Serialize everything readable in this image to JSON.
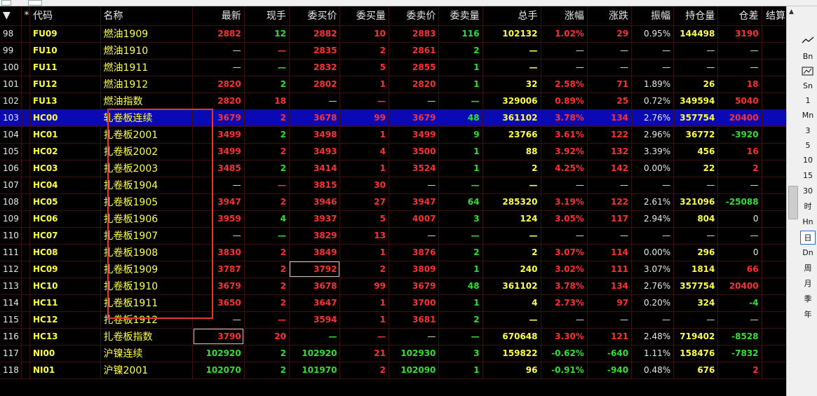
{
  "headers": [
    "",
    "*",
    "代码",
    "名称",
    "最新",
    "现手",
    "委买价",
    "委买量",
    "委卖价",
    "委卖量",
    "总手",
    "涨幅",
    "涨跌",
    "振幅",
    "持仓量",
    "仓差",
    "结算"
  ],
  "sort_indicator": "▼",
  "rows": [
    {
      "idx": "98",
      "code": "FU09",
      "name": "燃油1909",
      "cells": [
        [
          "2882",
          "red"
        ],
        [
          "12",
          "green"
        ],
        [
          "2882",
          "red"
        ],
        [
          "10",
          "red"
        ],
        [
          "2883",
          "red"
        ],
        [
          "116",
          "green"
        ],
        [
          "102132",
          "yellow"
        ],
        [
          "1.02%",
          "red"
        ],
        [
          "29",
          "red"
        ],
        [
          "0.95%",
          "white"
        ],
        [
          "144498",
          "yellow"
        ],
        [
          "3190",
          "red"
        ]
      ]
    },
    {
      "idx": "99",
      "code": "FU10",
      "name": "燃油1910",
      "cells": [
        [
          "—",
          "white"
        ],
        [
          "—",
          "red"
        ],
        [
          "2835",
          "red"
        ],
        [
          "2",
          "red"
        ],
        [
          "2861",
          "red"
        ],
        [
          "2",
          "green"
        ],
        [
          "—",
          "yellow"
        ],
        [
          "—",
          "white"
        ],
        [
          "—",
          "white"
        ],
        [
          "—",
          "white"
        ],
        [
          "—",
          "white"
        ],
        [
          "—",
          "white"
        ]
      ]
    },
    {
      "idx": "100",
      "code": "FU11",
      "name": "燃油1911",
      "cells": [
        [
          "—",
          "white"
        ],
        [
          "—",
          "green"
        ],
        [
          "2832",
          "red"
        ],
        [
          "5",
          "red"
        ],
        [
          "2855",
          "red"
        ],
        [
          "1",
          "green"
        ],
        [
          "—",
          "yellow"
        ],
        [
          "—",
          "white"
        ],
        [
          "—",
          "white"
        ],
        [
          "—",
          "white"
        ],
        [
          "—",
          "white"
        ],
        [
          "—",
          "white"
        ]
      ]
    },
    {
      "idx": "101",
      "code": "FU12",
      "name": "燃油1912",
      "cells": [
        [
          "2820",
          "red"
        ],
        [
          "2",
          "green"
        ],
        [
          "2802",
          "red"
        ],
        [
          "1",
          "red"
        ],
        [
          "2820",
          "red"
        ],
        [
          "1",
          "green"
        ],
        [
          "32",
          "yellow"
        ],
        [
          "2.58%",
          "red"
        ],
        [
          "71",
          "red"
        ],
        [
          "1.89%",
          "white"
        ],
        [
          "26",
          "yellow"
        ],
        [
          "18",
          "red"
        ]
      ]
    },
    {
      "idx": "102",
      "code": "FU13",
      "name": "燃油指数",
      "cells": [
        [
          "2820",
          "red"
        ],
        [
          "18",
          "red"
        ],
        [
          "—",
          "white"
        ],
        [
          "—",
          "red"
        ],
        [
          "—",
          "white"
        ],
        [
          "—",
          "green"
        ],
        [
          "329006",
          "yellow"
        ],
        [
          "0.89%",
          "red"
        ],
        [
          "25",
          "red"
        ],
        [
          "0.72%",
          "white"
        ],
        [
          "349594",
          "yellow"
        ],
        [
          "5040",
          "red"
        ]
      ]
    },
    {
      "idx": "103",
      "code": "HC00",
      "name": "轧卷板连续",
      "sel": true,
      "cells": [
        [
          "3679",
          "red"
        ],
        [
          "2",
          "red"
        ],
        [
          "3678",
          "red"
        ],
        [
          "99",
          "red"
        ],
        [
          "3679",
          "red"
        ],
        [
          "48",
          "green"
        ],
        [
          "361102",
          "yellow"
        ],
        [
          "3.78%",
          "red"
        ],
        [
          "134",
          "red"
        ],
        [
          "2.76%",
          "white"
        ],
        [
          "357754",
          "yellow"
        ],
        [
          "20400",
          "red"
        ]
      ]
    },
    {
      "idx": "104",
      "code": "HC01",
      "name": "扎卷板2001",
      "cells": [
        [
          "3499",
          "red"
        ],
        [
          "2",
          "green"
        ],
        [
          "3498",
          "red"
        ],
        [
          "1",
          "red"
        ],
        [
          "3499",
          "red"
        ],
        [
          "9",
          "green"
        ],
        [
          "23766",
          "yellow"
        ],
        [
          "3.61%",
          "red"
        ],
        [
          "122",
          "red"
        ],
        [
          "2.96%",
          "white"
        ],
        [
          "36772",
          "yellow"
        ],
        [
          "-3920",
          "green"
        ]
      ]
    },
    {
      "idx": "105",
      "code": "HC02",
      "name": "扎卷板2002",
      "cells": [
        [
          "3499",
          "red"
        ],
        [
          "2",
          "red"
        ],
        [
          "3493",
          "red"
        ],
        [
          "4",
          "red"
        ],
        [
          "3500",
          "red"
        ],
        [
          "1",
          "green"
        ],
        [
          "88",
          "yellow"
        ],
        [
          "3.92%",
          "red"
        ],
        [
          "132",
          "red"
        ],
        [
          "3.39%",
          "white"
        ],
        [
          "456",
          "yellow"
        ],
        [
          "16",
          "red"
        ]
      ]
    },
    {
      "idx": "106",
      "code": "HC03",
      "name": "扎卷板2003",
      "cells": [
        [
          "3485",
          "red"
        ],
        [
          "2",
          "green"
        ],
        [
          "3414",
          "red"
        ],
        [
          "1",
          "red"
        ],
        [
          "3524",
          "red"
        ],
        [
          "1",
          "green"
        ],
        [
          "2",
          "yellow"
        ],
        [
          "4.25%",
          "red"
        ],
        [
          "142",
          "red"
        ],
        [
          "0.00%",
          "white"
        ],
        [
          "22",
          "yellow"
        ],
        [
          "2",
          "red"
        ]
      ]
    },
    {
      "idx": "107",
      "code": "HC04",
      "name": "扎卷板1904",
      "cells": [
        [
          "—",
          "white"
        ],
        [
          "—",
          "red"
        ],
        [
          "3815",
          "red"
        ],
        [
          "30",
          "red"
        ],
        [
          "—",
          "white"
        ],
        [
          "—",
          "green"
        ],
        [
          "—",
          "yellow"
        ],
        [
          "—",
          "white"
        ],
        [
          "—",
          "white"
        ],
        [
          "—",
          "white"
        ],
        [
          "—",
          "white"
        ],
        [
          "—",
          "white"
        ]
      ]
    },
    {
      "idx": "108",
      "code": "HC05",
      "name": "扎卷板1905",
      "cells": [
        [
          "3947",
          "red"
        ],
        [
          "2",
          "red"
        ],
        [
          "3946",
          "red"
        ],
        [
          "27",
          "red"
        ],
        [
          "3947",
          "red"
        ],
        [
          "64",
          "green"
        ],
        [
          "285320",
          "yellow"
        ],
        [
          "3.19%",
          "red"
        ],
        [
          "122",
          "red"
        ],
        [
          "2.61%",
          "white"
        ],
        [
          "321096",
          "yellow"
        ],
        [
          "-25088",
          "green"
        ]
      ]
    },
    {
      "idx": "109",
      "code": "HC06",
      "name": "扎卷板1906",
      "cells": [
        [
          "3959",
          "red"
        ],
        [
          "4",
          "green"
        ],
        [
          "3937",
          "red"
        ],
        [
          "5",
          "red"
        ],
        [
          "4007",
          "red"
        ],
        [
          "3",
          "green"
        ],
        [
          "124",
          "yellow"
        ],
        [
          "3.05%",
          "red"
        ],
        [
          "117",
          "red"
        ],
        [
          "2.94%",
          "white"
        ],
        [
          "804",
          "yellow"
        ],
        [
          "0",
          "white"
        ]
      ]
    },
    {
      "idx": "110",
      "code": "HC07",
      "name": "扎卷板1907",
      "cells": [
        [
          "—",
          "white"
        ],
        [
          "—",
          "green"
        ],
        [
          "3829",
          "red"
        ],
        [
          "13",
          "red"
        ],
        [
          "—",
          "white"
        ],
        [
          "—",
          "green"
        ],
        [
          "—",
          "yellow"
        ],
        [
          "—",
          "white"
        ],
        [
          "—",
          "white"
        ],
        [
          "—",
          "white"
        ],
        [
          "—",
          "white"
        ],
        [
          "—",
          "white"
        ]
      ]
    },
    {
      "idx": "111",
      "code": "HC08",
      "name": "扎卷板1908",
      "cells": [
        [
          "3830",
          "red"
        ],
        [
          "2",
          "red"
        ],
        [
          "3849",
          "red"
        ],
        [
          "1",
          "red"
        ],
        [
          "3876",
          "red"
        ],
        [
          "2",
          "green"
        ],
        [
          "2",
          "yellow"
        ],
        [
          "3.07%",
          "red"
        ],
        [
          "114",
          "red"
        ],
        [
          "0.00%",
          "white"
        ],
        [
          "296",
          "yellow"
        ],
        [
          "0",
          "white"
        ]
      ]
    },
    {
      "idx": "112",
      "code": "HC09",
      "name": "扎卷板1909",
      "cells": [
        [
          "3787",
          "red"
        ],
        [
          "2",
          "red"
        ],
        [
          "3792",
          "red",
          true
        ],
        [
          "2",
          "red"
        ],
        [
          "3809",
          "red"
        ],
        [
          "1",
          "green"
        ],
        [
          "240",
          "yellow"
        ],
        [
          "3.02%",
          "red"
        ],
        [
          "111",
          "red"
        ],
        [
          "3.07%",
          "white"
        ],
        [
          "1814",
          "yellow"
        ],
        [
          "66",
          "red"
        ]
      ]
    },
    {
      "idx": "113",
      "code": "HC10",
      "name": "扎卷板1910",
      "cells": [
        [
          "3679",
          "red"
        ],
        [
          "2",
          "red"
        ],
        [
          "3678",
          "red"
        ],
        [
          "99",
          "red"
        ],
        [
          "3679",
          "red"
        ],
        [
          "48",
          "green"
        ],
        [
          "361102",
          "yellow"
        ],
        [
          "3.78%",
          "red"
        ],
        [
          "134",
          "red"
        ],
        [
          "2.76%",
          "white"
        ],
        [
          "357754",
          "yellow"
        ],
        [
          "20400",
          "red"
        ]
      ]
    },
    {
      "idx": "114",
      "code": "HC11",
      "name": "扎卷板1911",
      "cells": [
        [
          "3650",
          "red"
        ],
        [
          "2",
          "red"
        ],
        [
          "3647",
          "red"
        ],
        [
          "1",
          "red"
        ],
        [
          "3700",
          "red"
        ],
        [
          "1",
          "green"
        ],
        [
          "4",
          "yellow"
        ],
        [
          "2.73%",
          "red"
        ],
        [
          "97",
          "red"
        ],
        [
          "0.20%",
          "white"
        ],
        [
          "324",
          "yellow"
        ],
        [
          "-4",
          "green"
        ]
      ]
    },
    {
      "idx": "115",
      "code": "HC12",
      "name": "扎卷板1912",
      "cells": [
        [
          "—",
          "white"
        ],
        [
          "—",
          "red"
        ],
        [
          "3594",
          "red"
        ],
        [
          "1",
          "red"
        ],
        [
          "3681",
          "red"
        ],
        [
          "2",
          "green"
        ],
        [
          "—",
          "yellow"
        ],
        [
          "—",
          "white"
        ],
        [
          "—",
          "white"
        ],
        [
          "—",
          "white"
        ],
        [
          "—",
          "white"
        ],
        [
          "—",
          "white"
        ]
      ]
    },
    {
      "idx": "116",
      "code": "HC13",
      "name": "扎卷板指数",
      "cells": [
        [
          "3790",
          "red",
          true
        ],
        [
          "20",
          "red"
        ],
        [
          "—",
          "green"
        ],
        [
          "—",
          "red"
        ],
        [
          "—",
          "white"
        ],
        [
          "—",
          "green"
        ],
        [
          "670648",
          "yellow"
        ],
        [
          "3.30%",
          "red"
        ],
        [
          "121",
          "red"
        ],
        [
          "2.48%",
          "white"
        ],
        [
          "719402",
          "yellow"
        ],
        [
          "-8528",
          "green"
        ]
      ]
    },
    {
      "idx": "117",
      "code": "NI00",
      "name": "沪镍连续",
      "cells": [
        [
          "102920",
          "green"
        ],
        [
          "2",
          "green"
        ],
        [
          "102920",
          "green"
        ],
        [
          "21",
          "red"
        ],
        [
          "102930",
          "green"
        ],
        [
          "3",
          "green"
        ],
        [
          "159822",
          "yellow"
        ],
        [
          "-0.62%",
          "green"
        ],
        [
          "-640",
          "green"
        ],
        [
          "1.11%",
          "white"
        ],
        [
          "158476",
          "yellow"
        ],
        [
          "-7832",
          "green"
        ]
      ]
    },
    {
      "idx": "118",
      "code": "NI01",
      "name": "沪镍2001",
      "cells": [
        [
          "102070",
          "green"
        ],
        [
          "2",
          "green"
        ],
        [
          "101970",
          "green"
        ],
        [
          "2",
          "red"
        ],
        [
          "102090",
          "green"
        ],
        [
          "1",
          "green"
        ],
        [
          "96",
          "yellow"
        ],
        [
          "-0.91%",
          "green"
        ],
        [
          "-940",
          "green"
        ],
        [
          "0.48%",
          "white"
        ],
        [
          "676",
          "yellow"
        ],
        [
          "2",
          "red"
        ]
      ]
    }
  ],
  "right_panel": [
    "Bn",
    "Sn",
    "1",
    "Mn",
    "3",
    "5",
    "10",
    "15",
    "30",
    "时",
    "Hn",
    "日",
    "Dn",
    "周",
    "月",
    "季",
    "年"
  ],
  "right_panel_active": "日",
  "colors": {
    "up": "#ff3030",
    "down": "#30e030",
    "volume": "#ffff40",
    "selected_row": "#0a0ab4",
    "highlight_box": "#e03a2a"
  }
}
